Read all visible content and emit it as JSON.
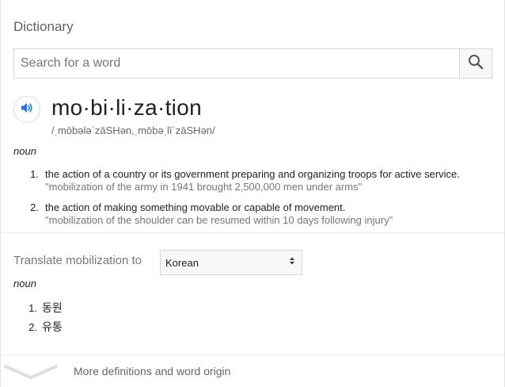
{
  "title": "Dictionary",
  "search": {
    "placeholder": "Search for a word",
    "value": ""
  },
  "entry": {
    "word": "mo·bi·li·za·tion",
    "phonetic": "/ˌmōbələˈzāSHən,ˌmōbəˌlīˈzāSHən/",
    "part_of_speech": "noun",
    "definitions": [
      {
        "number": "1.",
        "text": "the action of a country or its government preparing and organizing troops for active service.",
        "example": "\"mobilization of the army in 1941 brought 2,500,000 men under arms\""
      },
      {
        "number": "2.",
        "text": "the action of making something movable or capable of movement.",
        "example": "\"mobilization of the shoulder can be resumed within 10 days following injury\""
      }
    ]
  },
  "translate": {
    "label": "Translate mobilization to",
    "language": "Korean",
    "part_of_speech": "noun",
    "items": [
      {
        "number": "1.",
        "word": "동원"
      },
      {
        "number": "2.",
        "word": "유통"
      }
    ]
  },
  "more_link": "More definitions and word origin",
  "colors": {
    "speaker_accent": "#1a73e8",
    "example_text": "#767676"
  }
}
